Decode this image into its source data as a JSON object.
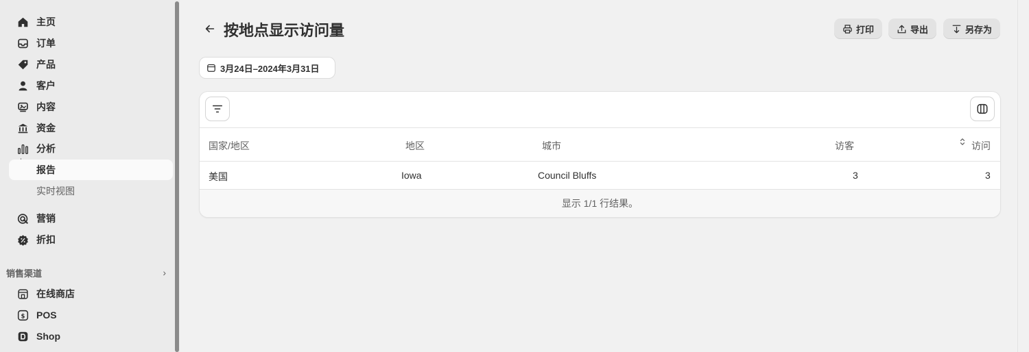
{
  "sidebar": {
    "items": [
      {
        "label": "主页",
        "icon": "home-icon"
      },
      {
        "label": "订单",
        "icon": "inbox-icon"
      },
      {
        "label": "产品",
        "icon": "tag-icon"
      },
      {
        "label": "客户",
        "icon": "person-icon"
      },
      {
        "label": "内容",
        "icon": "content-icon"
      },
      {
        "label": "资金",
        "icon": "bank-icon"
      },
      {
        "label": "分析",
        "icon": "bar-chart-icon"
      },
      {
        "label": "报告",
        "icon": ""
      },
      {
        "label": "实时视图",
        "icon": ""
      },
      {
        "label": "营销",
        "icon": "target-icon"
      },
      {
        "label": "折扣",
        "icon": "discount-icon"
      }
    ],
    "sales_channels": {
      "header": "销售渠道",
      "items": [
        {
          "label": "在线商店",
          "icon": "store-icon"
        },
        {
          "label": "POS",
          "icon": "pos-icon"
        },
        {
          "label": "Shop",
          "icon": "shop-icon"
        }
      ]
    }
  },
  "header": {
    "title": "按地点显示访问量",
    "print_label": "打印",
    "export_label": "导出",
    "save_as_label": "另存为"
  },
  "date_range": "3月24日–2024年3月31日",
  "table": {
    "columns": [
      "国家/地区",
      "地区",
      "城市",
      "访客",
      "访问"
    ],
    "rows": [
      [
        "美国",
        "Iowa",
        "Council Bluffs",
        "3",
        "3"
      ]
    ],
    "footer": "显示 1/1 行结果。"
  }
}
